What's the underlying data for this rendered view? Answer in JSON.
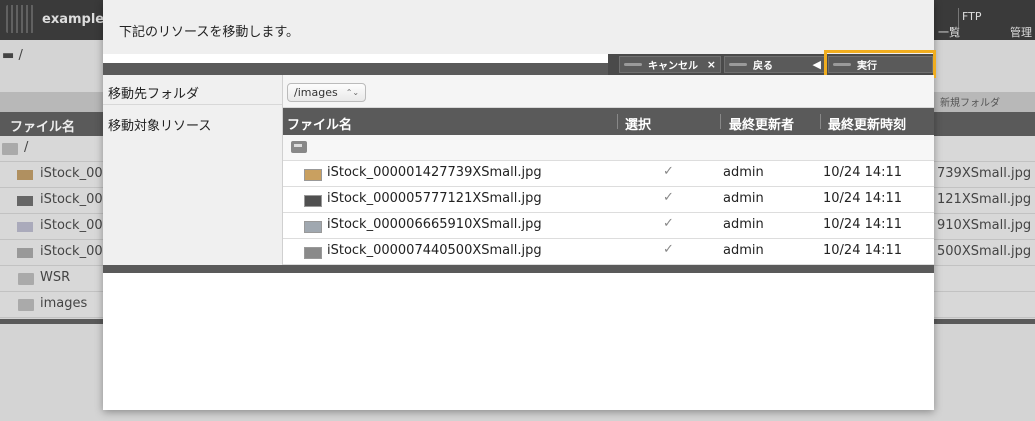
{
  "background": {
    "app_title": "examples",
    "nav": {
      "ichiran": "一覧",
      "ftp": "FTP",
      "kanri": "管理"
    },
    "path": "/",
    "new_folder": "新規フォルダ",
    "header_label": "ファイル名",
    "rows": [
      {
        "name": "/",
        "right": ""
      },
      {
        "name": "iStock_00",
        "right": "739XSmall.jpg"
      },
      {
        "name": "iStock_00",
        "right": "121XSmall.jpg"
      },
      {
        "name": "iStock_00",
        "right": "910XSmall.jpg"
      },
      {
        "name": "iStock_00",
        "right": "500XSmall.jpg"
      },
      {
        "name": "WSR",
        "right": ""
      },
      {
        "name": "images",
        "right": ""
      }
    ]
  },
  "modal": {
    "message": "下記のリソースを移動します。",
    "buttons": {
      "cancel": {
        "label": "キャンセル",
        "icon": "×"
      },
      "back": {
        "label": "戻る",
        "icon": "◀"
      },
      "execute": {
        "label": "実行"
      }
    },
    "dest_label": "移動先フォルダ",
    "dest_value": "/images",
    "dest_arrows": "⌃⌄",
    "targets_label": "移動対象リソース",
    "columns": {
      "filename": "ファイル名",
      "select": "選択",
      "updater": "最終更新者",
      "updated": "最終更新時刻"
    },
    "files": [
      {
        "name": "iStock_000001427739XSmall.jpg",
        "selected": "✓",
        "updater": "admin",
        "updated": "10/24 14:11",
        "thumb_color": "#c9a060"
      },
      {
        "name": "iStock_000005777121XSmall.jpg",
        "selected": "✓",
        "updater": "admin",
        "updated": "10/24 14:11",
        "thumb_color": "#505050"
      },
      {
        "name": "iStock_000006665910XSmall.jpg",
        "selected": "✓",
        "updater": "admin",
        "updated": "10/24 14:11",
        "thumb_color": "#a0a8b0"
      },
      {
        "name": "iStock_000007440500XSmall.jpg",
        "selected": "✓",
        "updater": "admin",
        "updated": "10/24 14:11",
        "thumb_color": "#8a8a8a"
      }
    ]
  },
  "colors": {
    "highlight": "#f0ad1f",
    "bar": "#5a5a5a"
  }
}
